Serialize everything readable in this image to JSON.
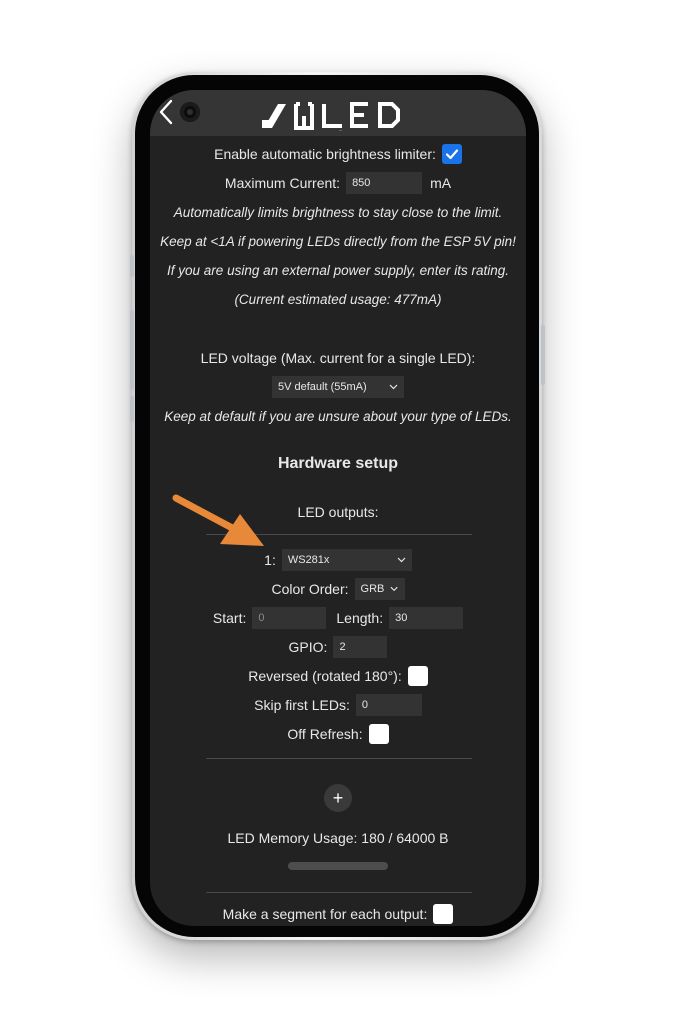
{
  "header": {
    "logo_text": "WLED"
  },
  "power": {
    "brightness_limiter_label": "Enable automatic brightness limiter:",
    "brightness_limiter_checked": true,
    "max_current_label": "Maximum Current:",
    "max_current_value": "850",
    "max_current_unit": "mA",
    "note_1": "Automatically limits brightness to stay close to the limit.",
    "note_2": "Keep at <1A if powering LEDs directly from the ESP 5V pin!",
    "note_3": "If you are using an external power supply, enter its rating.",
    "estimated_usage": "(Current estimated usage: 477mA)"
  },
  "led_voltage": {
    "label": "LED voltage (Max. current for a single LED):",
    "selected": "5V default (55mA)",
    "note": "Keep at default if you are unsure about your type of LEDs."
  },
  "hardware": {
    "title": "Hardware setup",
    "outputs_label": "LED outputs:",
    "output_index": "1:",
    "led_type": "WS281x",
    "color_order_label": "Color Order:",
    "color_order": "GRB",
    "start_label": "Start:",
    "start_placeholder": "0",
    "length_label": "Length:",
    "length_value": "30",
    "gpio_label": "GPIO:",
    "gpio_value": "2",
    "reversed_label": "Reversed (rotated 180°):",
    "reversed_checked": false,
    "skip_label": "Skip first LEDs:",
    "skip_value": "0",
    "off_refresh_label": "Off Refresh:",
    "off_refresh_checked": false,
    "add_output_label": "+",
    "memory_usage": "LED Memory Usage: 180 / 64000 B",
    "segment_each_label": "Make a segment for each output:",
    "segment_each_checked": false
  },
  "colors": {
    "background": "#222222",
    "header": "#353535",
    "input": "#333333",
    "accent_checkbox": "#1a73e8",
    "annotation_arrow": "#e8893a"
  }
}
